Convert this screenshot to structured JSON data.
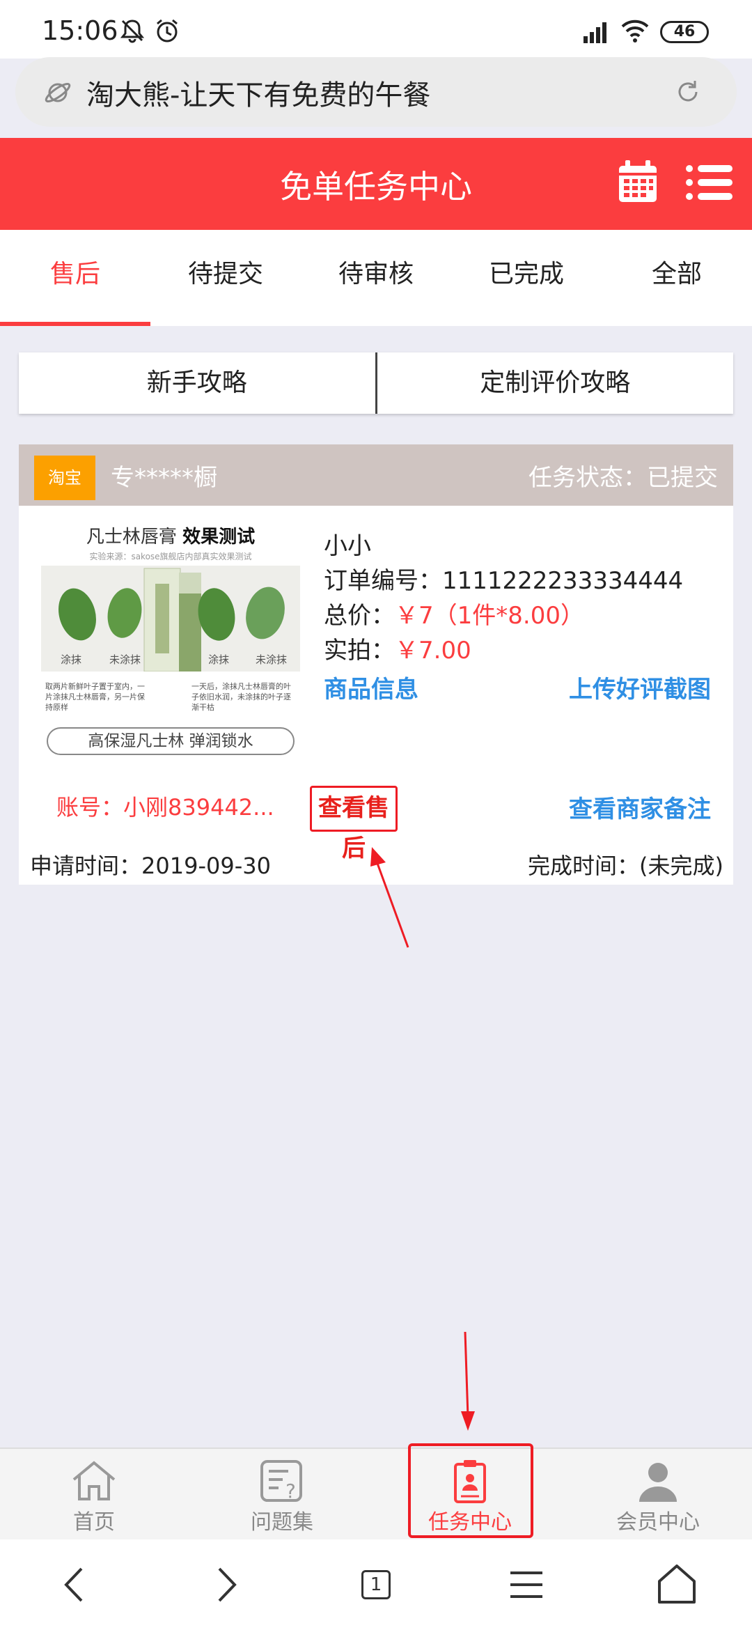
{
  "status_bar": {
    "time": "15:06",
    "battery": "46"
  },
  "address_bar": {
    "url_text": "淘大熊-让天下有免费的午餐"
  },
  "header": {
    "title": "免单任务中心"
  },
  "tabs": [
    {
      "label": "售后"
    },
    {
      "label": "待提交"
    },
    {
      "label": "待审核"
    },
    {
      "label": "已完成"
    },
    {
      "label": "全部"
    }
  ],
  "guides": {
    "newbie": "新手攻略",
    "custom_review": "定制评价攻略"
  },
  "task": {
    "platform_badge": "淘宝",
    "shop_name": "专*****橱",
    "status_label": "任务状态：",
    "status_value": "已提交",
    "thumbnail": {
      "title_plain": "凡士林唇膏 ",
      "title_bold": "效果测试",
      "subtitle": "实验来源：sakose旗舰店内部真实效果测试",
      "caption_1": "涂抹",
      "caption_2": "未涂抹",
      "caption_3": "涂抹",
      "caption_4": "未涂抹",
      "body_left": "取两片新鲜叶子置于室内，一片涂抹凡士林唇膏，另一片保持原样",
      "body_right": "一天后，涂抹凡士林唇膏的叶子依旧水润，未涂抹的叶子逐渐干枯",
      "slogan": "高保湿凡士林 弹润锁水"
    },
    "buyer": "小小",
    "order_label": "订单编号：",
    "order_no": "1111222233334444",
    "total_label": "总价：",
    "total_value": "￥7（1件*8.00）",
    "paid_label": "实拍：",
    "paid_value": "￥7.00",
    "account": "账号：小刚839442...",
    "links": {
      "product_info": "商品信息",
      "upload_review": "上传好评截图",
      "view_aftersale": "查看售后",
      "view_merchant_note": "查看商家备注"
    },
    "apply_time": "申请时间：2019-09-30",
    "finish_time": "完成时间：(未完成)"
  },
  "bottom_nav": [
    {
      "label": "首页",
      "icon": "home-icon"
    },
    {
      "label": "问题集",
      "icon": "question-list-icon"
    },
    {
      "label": "任务中心",
      "icon": "task-clipboard-icon"
    },
    {
      "label": "会员中心",
      "icon": "user-icon"
    }
  ],
  "browser_bar": {
    "tab_count": "1"
  },
  "colors": {
    "brand_red": "#fb3d3f",
    "link_blue": "#2f8fe4",
    "badge_orange": "#fca000",
    "card_header": "#cfc4c1"
  }
}
